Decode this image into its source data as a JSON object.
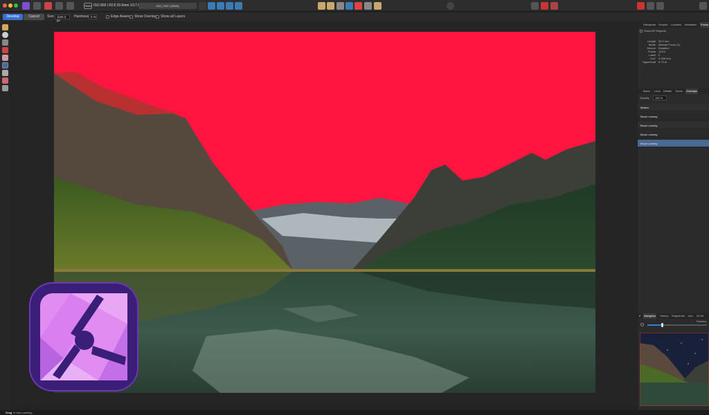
{
  "app": {
    "name": "Affinity Photo 2"
  },
  "topbar": {
    "file_info": "ISO 800 | f/2.8 20.0mm 1/17.0s",
    "doc_label": "IMG_0087 (36MB)",
    "raw_badge": "RAW"
  },
  "context": {
    "develop_label": "Develop",
    "cancel_label": "Cancel",
    "size_label": "Size",
    "size_value": "1194.2 px",
    "hardness_label": "Hardness",
    "hardness_value": "0 %",
    "edge_detect_label": "Edge Aware",
    "show_overlay_label": "Show Overlay",
    "show_all_label": "Show all Layers"
  },
  "panel": {
    "top_tabs": [
      "Histogram",
      "Scopes",
      "Location",
      "Metadata",
      "Focus"
    ],
    "focus_header": "Show AF Regions",
    "focus_rows": [
      {
        "label": "Length",
        "value": "24.0 mm"
      },
      {
        "label": "Mode",
        "value": "Manual Focus (1)"
      },
      {
        "label": "Source",
        "value": "Disabled"
      },
      {
        "label": "Points",
        "value": "10/10"
      },
      {
        "label": "Label",
        "value": "0"
      },
      {
        "label": "CoC",
        "value": "0.030 mm"
      },
      {
        "label": "Hyperfocal",
        "value": "6.73 m"
      }
    ],
    "mid_tabs": [
      "Basic",
      "Lens",
      "Details",
      "Tones",
      "Overlays"
    ],
    "opacity_label": "Opacity",
    "opacity_value": "100 %",
    "overlays": [
      "Master",
      "Brush overlay",
      "Brush overlay",
      "Brush overlay",
      "Brush overlay"
    ],
    "selected_overlay_index": 4,
    "bottom_tabs": [
      "Navigator",
      "History",
      "Snapshots",
      "Info",
      "32-bit Preview"
    ]
  },
  "status": {
    "bold": "Drag",
    "text": "to start painting."
  },
  "colors": {
    "accent": "#3a6fd0",
    "overlay_red": "#ff1540",
    "selected_row": "#4a6a96"
  }
}
